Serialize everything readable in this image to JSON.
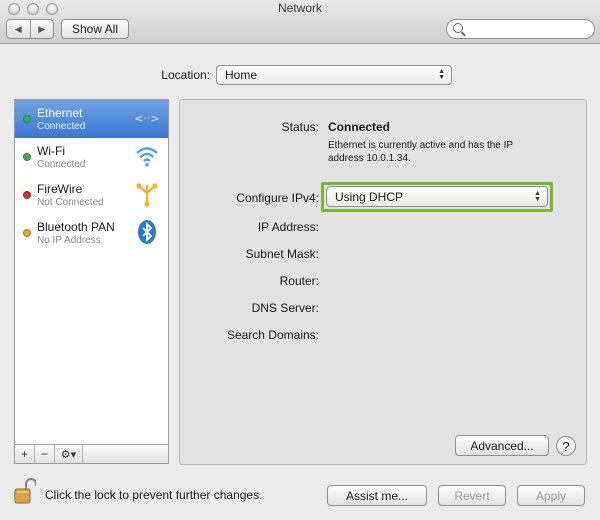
{
  "window": {
    "title": "Network"
  },
  "toolbar": {
    "show_all_label": "Show All",
    "search_placeholder": ""
  },
  "location": {
    "label": "Location:",
    "value": "Home"
  },
  "services": [
    {
      "name": "Ethernet",
      "status": "Connected",
      "dot_color": "#38b34a",
      "icon": "ethernet-arrows-icon",
      "selected": true
    },
    {
      "name": "Wi-Fi",
      "status": "Connected",
      "dot_color": "#38b34a",
      "icon": "wifi-icon",
      "selected": false
    },
    {
      "name": "FireWire",
      "status": "Not Connected",
      "dot_color": "#d9302b",
      "icon": "firewire-icon",
      "selected": false
    },
    {
      "name": "Bluetooth PAN",
      "status": "No IP Address",
      "dot_color": "#f1a526",
      "icon": "bluetooth-icon",
      "selected": false
    }
  ],
  "sidebar_controls": {
    "add": "+",
    "remove": "−",
    "gear": "⚙▾"
  },
  "detail": {
    "status_label": "Status:",
    "status_value": "Connected",
    "status_description": "Ethernet is currently active and has the IP address 10.0.1.34.",
    "configure_label": "Configure IPv4:",
    "configure_value": "Using DHCP",
    "fields": [
      {
        "label": "IP Address:",
        "value": ""
      },
      {
        "label": "Subnet Mask:",
        "value": ""
      },
      {
        "label": "Router:",
        "value": ""
      },
      {
        "label": "DNS Server:",
        "value": ""
      },
      {
        "label": "Search Domains:",
        "value": ""
      }
    ],
    "advanced_label": "Advanced...",
    "help_label": "?"
  },
  "footer": {
    "lock_text": "Click the lock to prevent further changes.",
    "assist_label": "Assist me...",
    "revert_label": "Revert",
    "apply_label": "Apply"
  },
  "colors": {
    "highlight_green": "#7ab828",
    "selection_blue": "#3b78d0"
  }
}
